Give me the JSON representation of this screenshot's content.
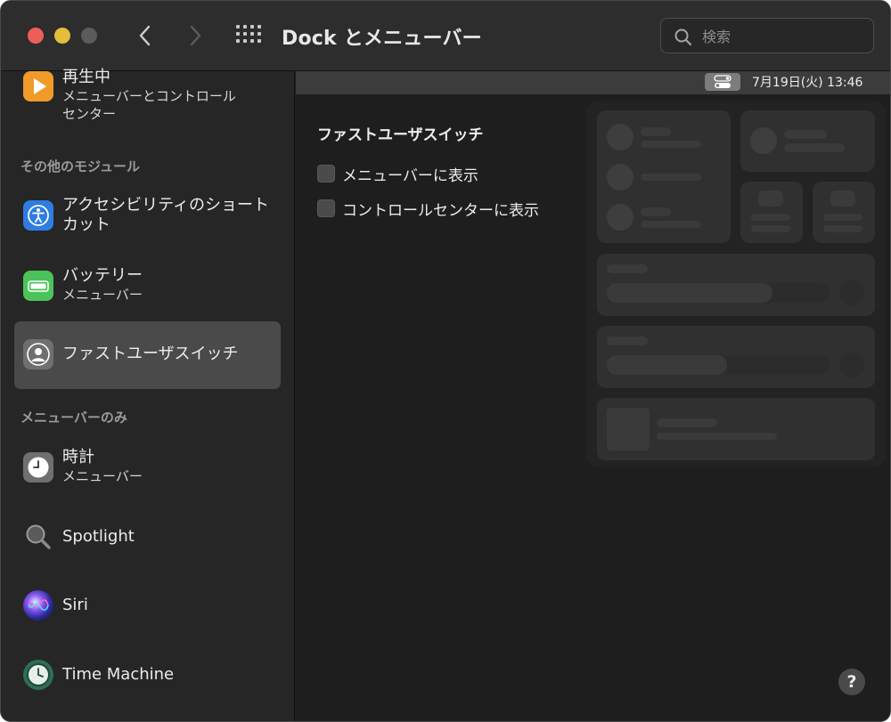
{
  "window": {
    "title": "Dock とメニューバー"
  },
  "search": {
    "placeholder": "検索"
  },
  "sidebar": {
    "top_item": {
      "label": "再生中",
      "sub": "メニューバーとコントロール\nセンター"
    },
    "sections": [
      {
        "header": "その他のモジュール",
        "items": [
          {
            "label": "アクセシビリティのショート\nカット",
            "sub": ""
          },
          {
            "label": "バッテリー",
            "sub": "メニューバー"
          },
          {
            "label": "ファストユーザスイッチ",
            "sub": "",
            "selected": true
          }
        ]
      },
      {
        "header": "メニューバーのみ",
        "items": [
          {
            "label": "時計",
            "sub": "メニューバー"
          },
          {
            "label": "Spotlight",
            "sub": ""
          },
          {
            "label": "Siri",
            "sub": ""
          },
          {
            "label": "Time Machine",
            "sub": ""
          }
        ]
      }
    ]
  },
  "main": {
    "menubar_clock": "7月19日(火)  13:46",
    "option_title": "ファストユーザスイッチ",
    "options": [
      {
        "label": "メニューバーに表示",
        "checked": false
      },
      {
        "label": "コントロールセンターに表示",
        "checked": false
      }
    ],
    "help_label": "?"
  },
  "colors": {
    "close": "#ec5f58",
    "minimize": "#e3bd3b",
    "now_playing_icon": "#f09a2a",
    "accessibility_icon": "#2f7de1",
    "battery_icon": "#4cc35a",
    "selected_row": "#4a4a4a"
  },
  "icons": {
    "back": "chevron-left-icon",
    "forward": "chevron-right-icon",
    "grid": "grid-icon",
    "search": "search-icon",
    "now_playing": "play-icon",
    "accessibility": "accessibility-icon",
    "battery": "battery-icon",
    "fast_user_switching": "user-icon",
    "clock": "clock-icon",
    "spotlight": "magnifier-icon",
    "siri": "siri-icon",
    "time_machine": "time-machine-icon",
    "control_center": "control-center-icon"
  }
}
